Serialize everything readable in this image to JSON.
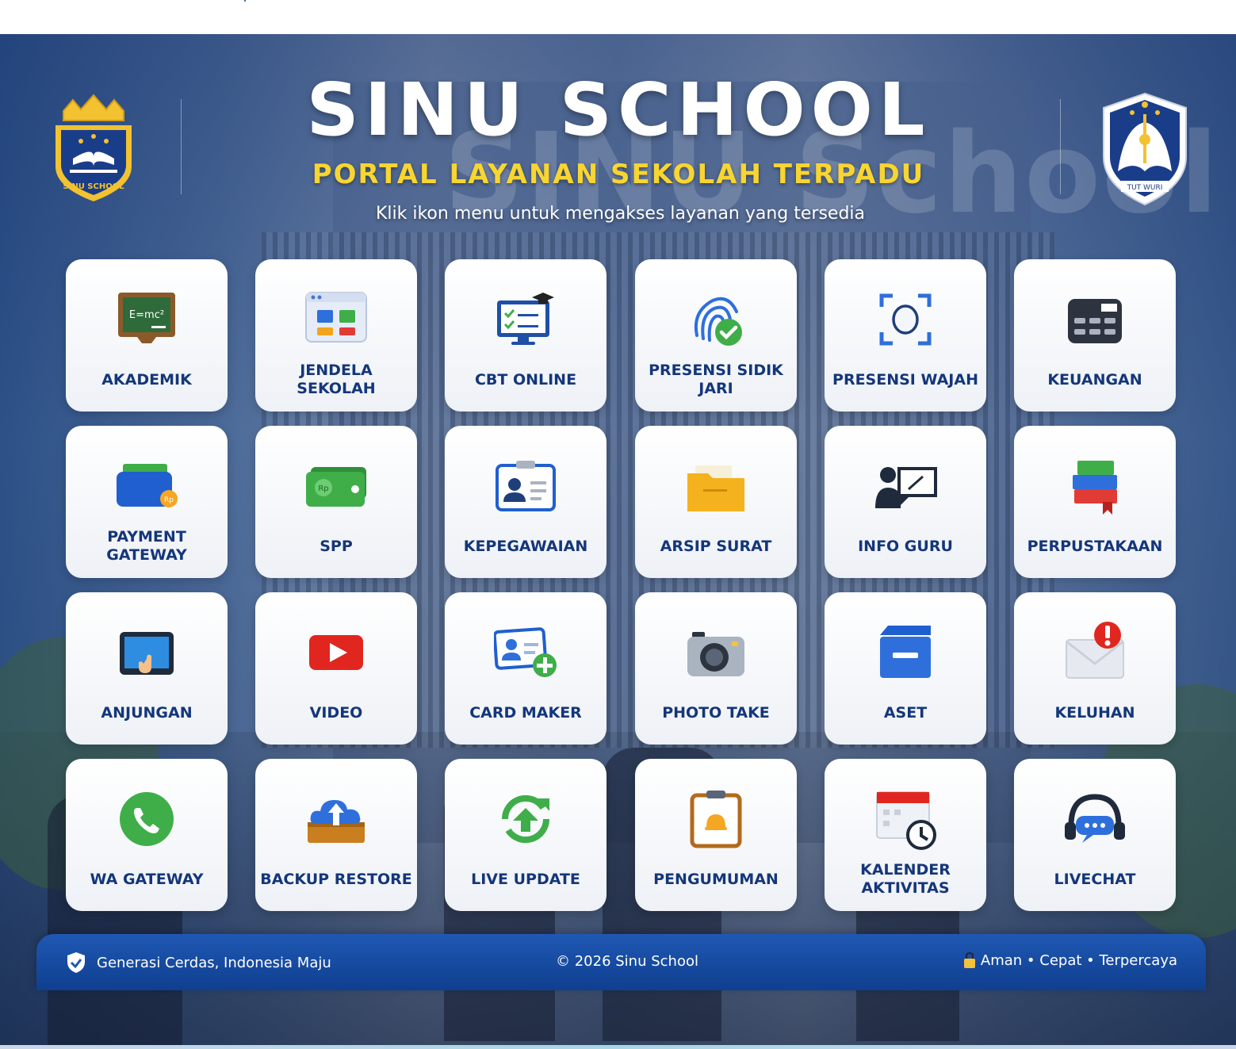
{
  "header": {
    "title": "SINU SCHOOL",
    "subtitle": "PORTAL LAYANAN SEKOLAH TERPADU",
    "tagline": "Klik ikon menu untuk mengakses layanan yang tersedia",
    "background_text": "SINU School",
    "left_logo_text": "SINU SCHOOL",
    "right_logo_text": "TUT WURI"
  },
  "menu": [
    {
      "label": "AKADEMIK",
      "icon": "chalkboard-icon",
      "icon_text": "E=mc²"
    },
    {
      "label": "JENDELA SEKOLAH",
      "icon": "app-window-icon"
    },
    {
      "label": "CBT ONLINE",
      "icon": "computer-test-icon"
    },
    {
      "label": "PRESENSI SIDIK JARI",
      "icon": "fingerprint-icon"
    },
    {
      "label": "PRESENSI WAJAH",
      "icon": "face-scan-icon"
    },
    {
      "label": "KEUANGAN",
      "icon": "calculator-icon"
    },
    {
      "label": "PAYMENT GATEWAY",
      "icon": "wallet-icon",
      "icon_text": "Rp"
    },
    {
      "label": "SPP",
      "icon": "money-icon",
      "icon_text": "Rp"
    },
    {
      "label": "KEPEGAWAIAN",
      "icon": "id-card-icon"
    },
    {
      "label": "ARSIP SURAT",
      "icon": "folder-icon"
    },
    {
      "label": "INFO GURU",
      "icon": "teacher-board-icon"
    },
    {
      "label": "PERPUSTAKAAN",
      "icon": "books-icon"
    },
    {
      "label": "ANJUNGAN",
      "icon": "tablet-touch-icon"
    },
    {
      "label": "VIDEO",
      "icon": "video-play-icon"
    },
    {
      "label": "CARD MAKER",
      "icon": "card-add-icon"
    },
    {
      "label": "PHOTO TAKE",
      "icon": "camera-icon"
    },
    {
      "label": "ASET",
      "icon": "archive-box-icon"
    },
    {
      "label": "KELUHAN",
      "icon": "mail-alert-icon"
    },
    {
      "label": "WA GATEWAY",
      "icon": "whatsapp-icon"
    },
    {
      "label": "BACKUP RESTORE",
      "icon": "cloud-upload-icon"
    },
    {
      "label": "LIVE UPDATE",
      "icon": "sync-update-icon"
    },
    {
      "label": "PENGUMUMAN",
      "icon": "clipboard-bell-icon"
    },
    {
      "label": "KALENDER AKTIVITAS",
      "icon": "calendar-clock-icon"
    },
    {
      "label": "LIVECHAT",
      "icon": "headset-chat-icon"
    }
  ],
  "footer": {
    "left_text": "Generasi Cerdas, Indonesia Maju",
    "center_text": "© 2026 Sinu School",
    "right_text": "Aman • Cepat • Terpercaya",
    "left_icon": "shield-check-icon",
    "right_icon": "lock-icon"
  },
  "colors": {
    "label": "#14367a",
    "subtitle": "#f8d531",
    "footer": "#1f58b4",
    "title": "#ffffff"
  }
}
